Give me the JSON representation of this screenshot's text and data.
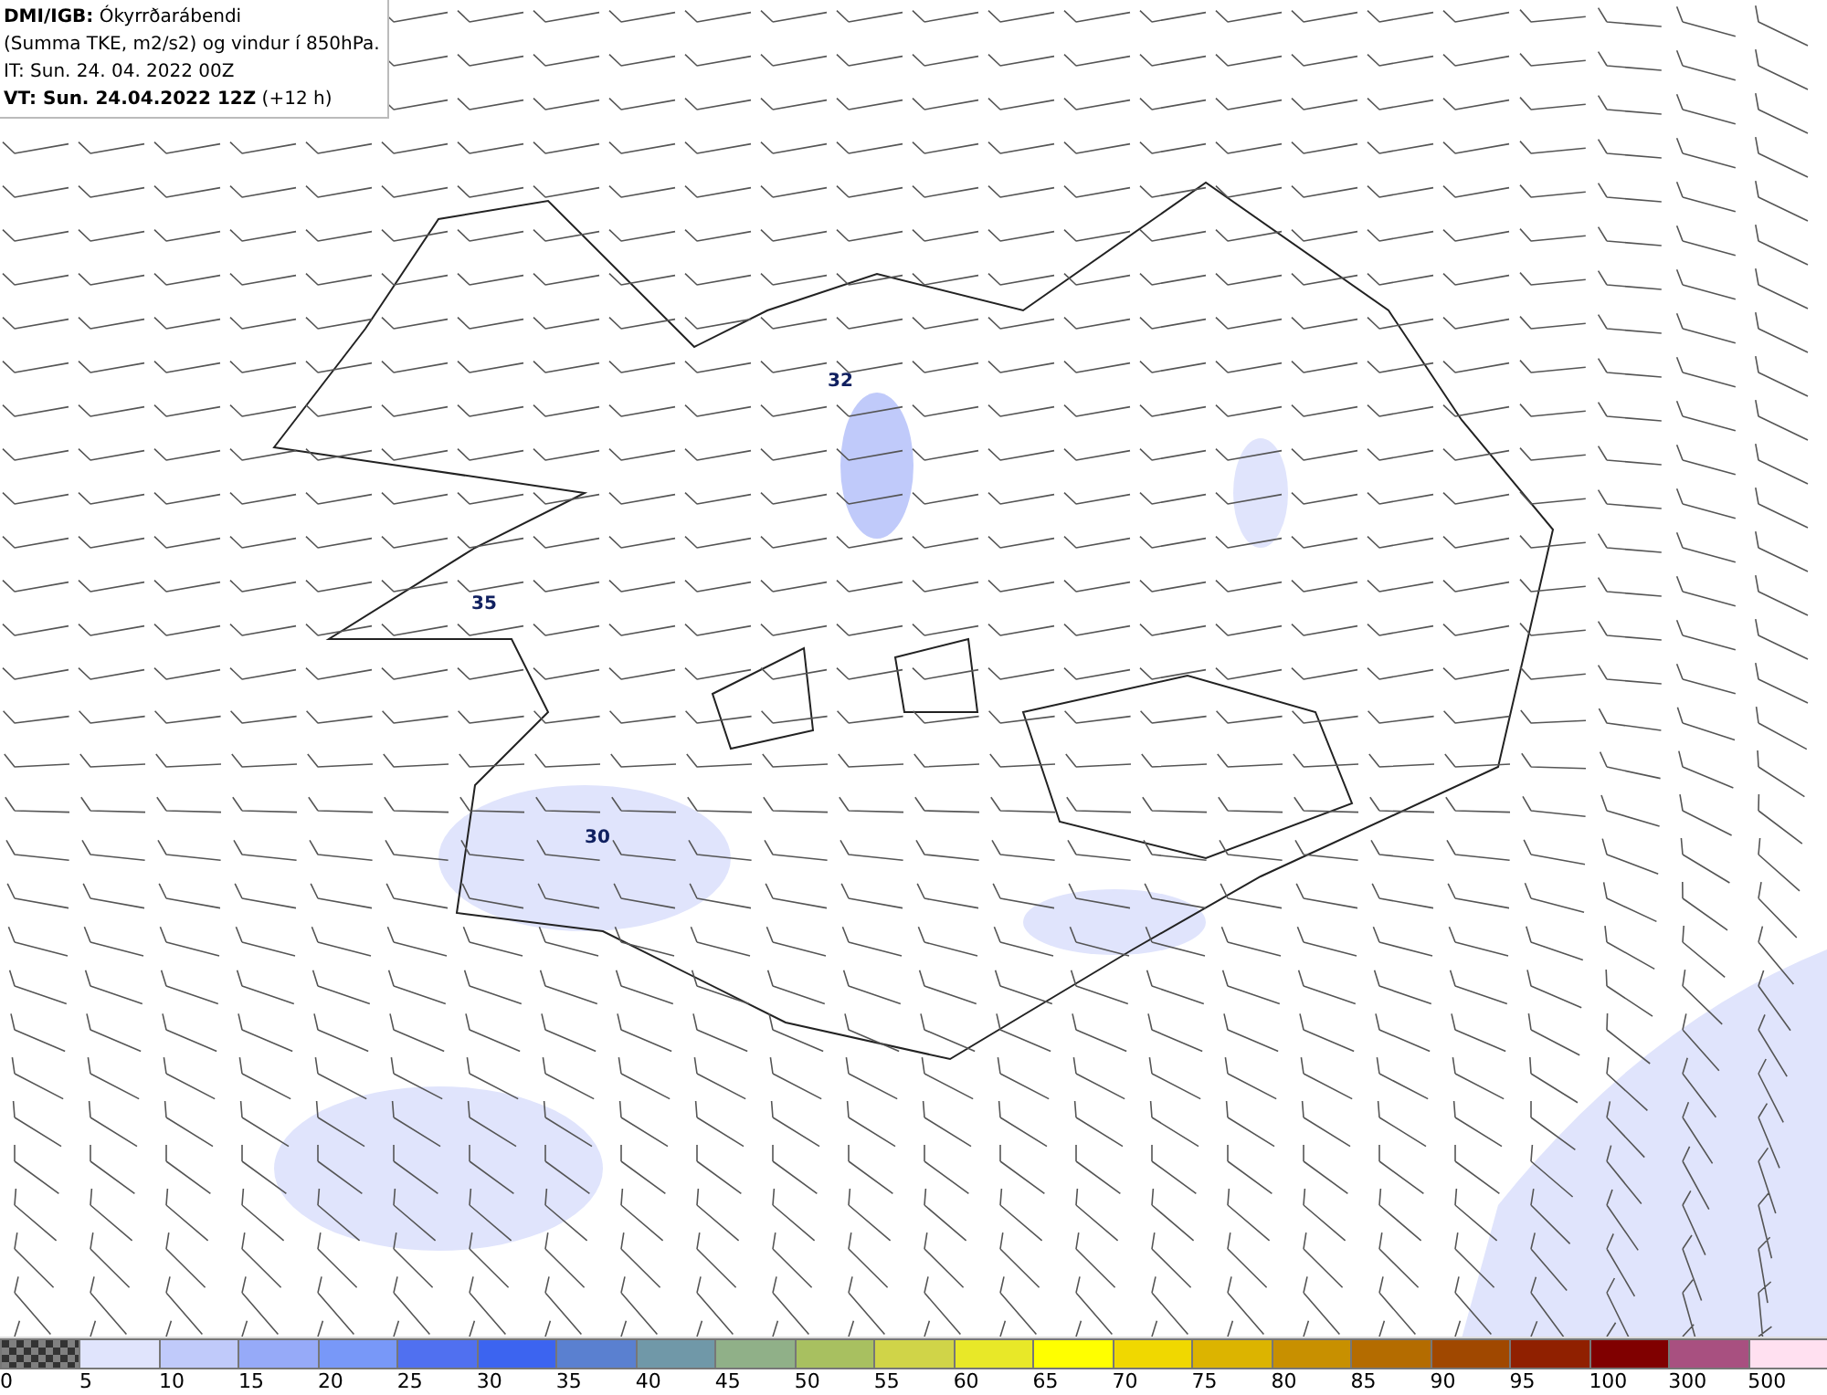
{
  "header": {
    "lines": [
      "**DMI/IGB:** Ókyrrðarábendi",
      "(Summa TKE, m2/s2) og vindur í 850hPa.",
      "IT: Sun. 24. 04. 2022 00Z",
      "**VT: Sun. 24.04.2022 12Z** (+12 h)"
    ]
  },
  "map": {
    "labels": [
      "32",
      "35",
      "30"
    ]
  },
  "legend": [
    {
      "label": "0",
      "color": "#808080",
      "kind": "checker"
    },
    {
      "label": "5",
      "color": "#e0e4fc",
      "kind": "solid"
    },
    {
      "label": "10",
      "color": "#c0cafa",
      "kind": "solid"
    },
    {
      "label": "15",
      "color": "#96aaf8",
      "kind": "solid"
    },
    {
      "label": "20",
      "color": "#7898f8",
      "kind": "solid"
    },
    {
      "label": "25",
      "color": "#5070f0",
      "kind": "solid"
    },
    {
      "label": "30",
      "color": "#3c64f0",
      "kind": "solid"
    },
    {
      "label": "35",
      "color": "#5a80d0",
      "kind": "solid"
    },
    {
      "label": "40",
      "color": "#7098a8",
      "kind": "solid"
    },
    {
      "label": "45",
      "color": "#90b088",
      "kind": "solid"
    },
    {
      "label": "50",
      "color": "#a8c060",
      "kind": "solid"
    },
    {
      "label": "55",
      "color": "#d0d448",
      "kind": "solid"
    },
    {
      "label": "60",
      "color": "#e8e828",
      "kind": "solid"
    },
    {
      "label": "65",
      "color": "#ffff00",
      "kind": "solid"
    },
    {
      "label": "70",
      "color": "#f0d800",
      "kind": "solid"
    },
    {
      "label": "75",
      "color": "#dcb400",
      "kind": "solid"
    },
    {
      "label": "80",
      "color": "#c89000",
      "kind": "solid"
    },
    {
      "label": "85",
      "color": "#b46c00",
      "kind": "solid"
    },
    {
      "label": "90",
      "color": "#a04800",
      "kind": "solid"
    },
    {
      "label": "95",
      "color": "#902000",
      "kind": "solid"
    },
    {
      "label": "100",
      "color": "#800000",
      "kind": "solid"
    },
    {
      "label": "300",
      "color": "#a85080",
      "kind": "solid"
    },
    {
      "label": "500",
      "color": "#ffe0f0",
      "kind": "solid"
    }
  ]
}
